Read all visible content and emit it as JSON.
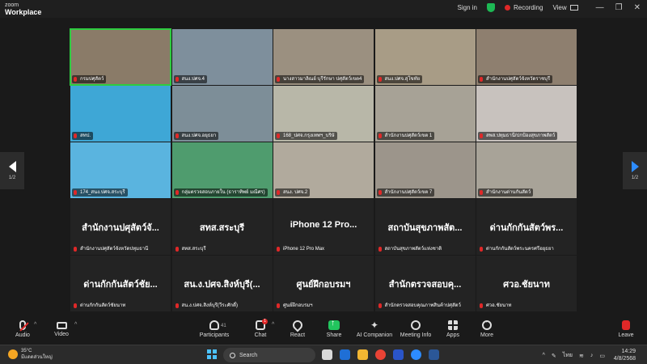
{
  "titlebar": {
    "brand_small": "zoom",
    "brand_large": "Workplace",
    "signin": "Sign in",
    "recording": "Recording",
    "view": "View"
  },
  "pager": {
    "left": "1/2",
    "right": "1/2"
  },
  "tiles": [
    {
      "kind": "video",
      "label": "กรมปศุสัตว์",
      "active": true,
      "color": "#8a7b68"
    },
    {
      "kind": "video",
      "label": "สนง.ปศจ.4",
      "color": "#7e8f9c"
    },
    {
      "kind": "video",
      "label": "นางสาวมาลิณย์ บุรีรักษา ปศุสัตว์เขต4",
      "color": "#9b9080"
    },
    {
      "kind": "video",
      "label": "สนง.ปศจ.สุโขทัย",
      "color": "#a89c86"
    },
    {
      "kind": "video",
      "label": "สำนักงานปศุสัตว์จังหวัดราชบุรี",
      "color": "#8e7f6f"
    },
    {
      "kind": "video",
      "label": "สทป.",
      "color": "#3ea7d6"
    },
    {
      "kind": "video",
      "label": "สนง.ปศจ.อยุธยา",
      "color": "#7d8e98"
    },
    {
      "kind": "video",
      "label": "168_ปศจ.กรุงเทพฯ_บริษั",
      "color": "#b8b7a8"
    },
    {
      "kind": "video",
      "label": "สำนักงานปศุสัตว์เขต 1",
      "color": "#a7a296"
    },
    {
      "kind": "video",
      "label": "สพส.ปทุมธานี/ปกป้องสุขภาพสัตว์",
      "color": "#c8c2be"
    },
    {
      "kind": "video",
      "label": "174_สนง.ปศจ.สระบุรี",
      "color": "#5ab4df"
    },
    {
      "kind": "video",
      "label": "กลุ่มตรวจสอบภายใน (ธาราทิพย์ มณีศร)",
      "color": "#4f9c6e"
    },
    {
      "kind": "video",
      "label": "สนง. ปศจ.2",
      "color": "#b1aa9d"
    },
    {
      "kind": "video",
      "label": "สำนักงานปศุสัตว์เขต 7",
      "color": "#9c958b"
    },
    {
      "kind": "video",
      "label": "สำนักงานด่านกันสัตว์",
      "color": "#a8a398"
    },
    {
      "kind": "name",
      "title": "สำนักงานปศุสัตว์จั...",
      "label": "สำนักงานปศุสัตว์จังหวัดปทุมธานี"
    },
    {
      "kind": "name",
      "title": "สทส.สระบุรี",
      "label": "สทส.สระบุรี"
    },
    {
      "kind": "name",
      "title": "iPhone 12 Pro...",
      "label": "iPhone 12 Pro Max"
    },
    {
      "kind": "name",
      "title": "สถาบันสุขภาพสัต...",
      "label": "สถาบันสุขภาพสัตว์แห่งชาติ"
    },
    {
      "kind": "name",
      "title": "ด่านกักกันสัตว์พร...",
      "label": "ด่านกักกันสัตว์พระนครศรีอยุธยา"
    },
    {
      "kind": "name",
      "title": "ด่านกักกันสัตว์ชัย...",
      "label": "ด่านกักกันสัตว์ชัยนาท"
    },
    {
      "kind": "name",
      "title": "สน.ง.ปศจ.สิงห์บุรี(...",
      "label": "สน.ง.ปศจ.สิงห์บุรี(วีระศักดิ์)"
    },
    {
      "kind": "name",
      "title": "ศูนย์ฝึกอบรมฯ",
      "label": "ศูนย์ฝึกอบรมฯ"
    },
    {
      "kind": "name",
      "title": "สำนักตรวจสอบคุ...",
      "label": "สำนักตรวจสอบคุณภาพสินค้าปศุสัตว์"
    },
    {
      "kind": "name",
      "title": "ศวอ.ชัยนาท",
      "label": "ศวอ.ชัยนาท"
    }
  ],
  "toolbar": {
    "audio": "Audio",
    "video": "Video",
    "participants": "Participants",
    "participants_count": "41",
    "chat": "Chat",
    "chat_badge": "1",
    "react": "React",
    "share": "Share",
    "ai": "AI Companion",
    "info": "Meeting Info",
    "apps": "Apps",
    "more": "More",
    "leave": "Leave"
  },
  "taskbar": {
    "temp": "35°C",
    "weather_desc": "มีแดดส่วนใหญ่",
    "search_placeholder": "Search",
    "lang": "ไทย",
    "time": "14:29",
    "date": "4/8/2568"
  }
}
